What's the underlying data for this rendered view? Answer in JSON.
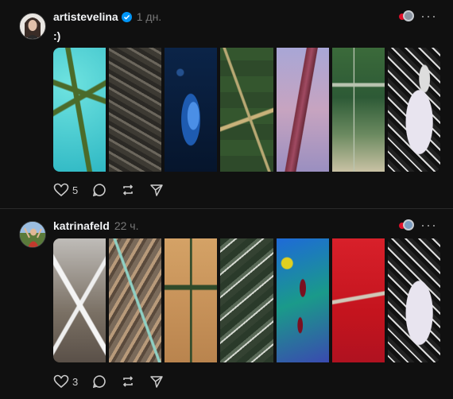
{
  "posts": [
    {
      "username": "artistevelina",
      "verified": true,
      "time": "1 дн.",
      "caption": ":)",
      "likes": "5",
      "more": "···"
    },
    {
      "username": "katrinafeld",
      "verified": false,
      "time": "22 ч.",
      "likes": "3",
      "more": "···"
    }
  ],
  "colors": {
    "background": "#101010",
    "text": "#f3f5f7",
    "muted": "#777777",
    "verified": "#0095f6"
  }
}
